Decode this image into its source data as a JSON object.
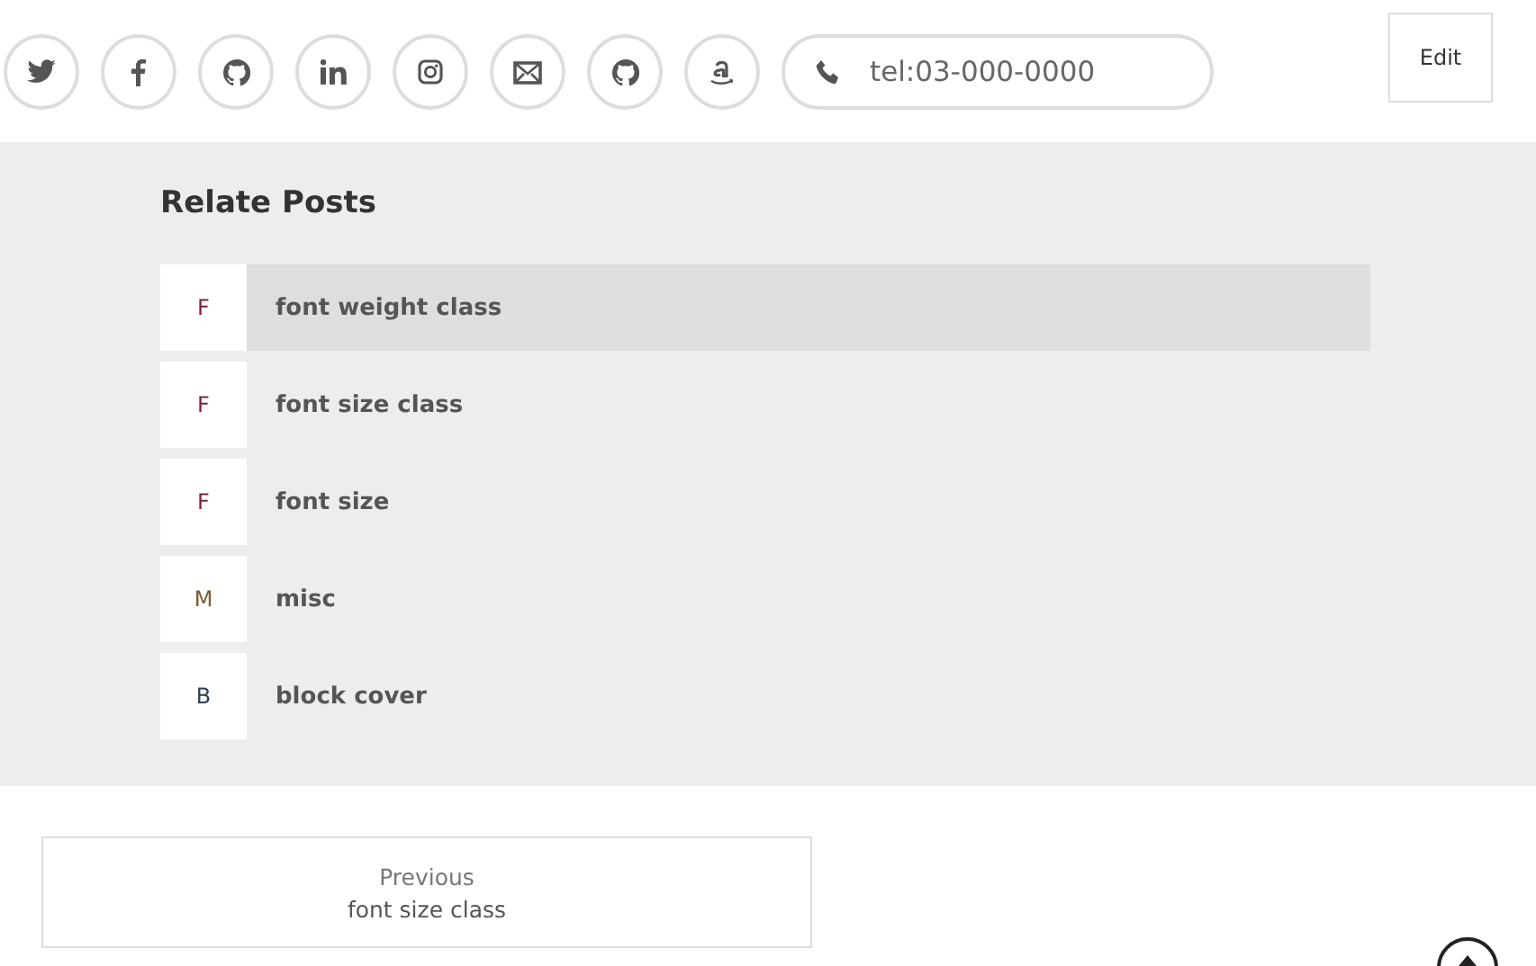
{
  "social_icons": [
    {
      "kind": "twitter"
    },
    {
      "kind": "facebook"
    },
    {
      "kind": "github"
    },
    {
      "kind": "linkedin"
    },
    {
      "kind": "instagram"
    },
    {
      "kind": "mail"
    },
    {
      "kind": "github"
    },
    {
      "kind": "amazon"
    }
  ],
  "phone": {
    "text": "tel:03-000-0000"
  },
  "edit_button": "Edit",
  "related": {
    "title": "Relate Posts",
    "items": [
      {
        "initial": "F",
        "color": "#7a1f3d",
        "title": "font weight class",
        "selected": true
      },
      {
        "initial": "F",
        "color": "#7a1f3d",
        "title": "font size class",
        "selected": false
      },
      {
        "initial": "F",
        "color": "#7a1f3d",
        "title": "font size",
        "selected": false
      },
      {
        "initial": "M",
        "color": "#7a5a2a",
        "title": "misc",
        "selected": false
      },
      {
        "initial": "B",
        "color": "#2f3e55",
        "title": "block cover",
        "selected": false
      }
    ]
  },
  "previous": {
    "label": "Previous",
    "title": "font size class"
  }
}
